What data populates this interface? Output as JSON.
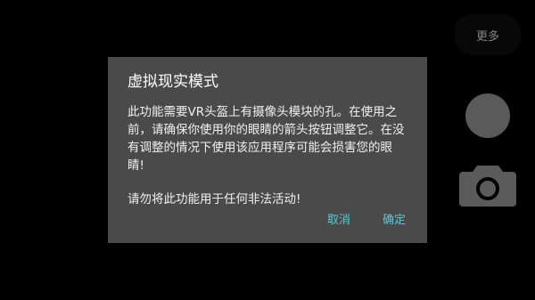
{
  "side_controls": {
    "more_label": "更多",
    "shutter_icon": "shutter-circle",
    "camera_icon": "camera-icon"
  },
  "dialog": {
    "title": "虚拟现实模式",
    "body": "此功能需要VR头盔上有摄像头模块的孔。在使用之前，请确保你使用你的眼睛的箭头按钮调整它。在没有调整的情况下使用该应用程序可能会损害您的眼睛!",
    "warning": "请勿将此功能用于任何非法活动!",
    "cancel_label": "取消",
    "confirm_label": "确定"
  },
  "colors": {
    "background": "#000000",
    "dialog_bg": "#4a4a4a",
    "accent": "#5ec6d6"
  }
}
